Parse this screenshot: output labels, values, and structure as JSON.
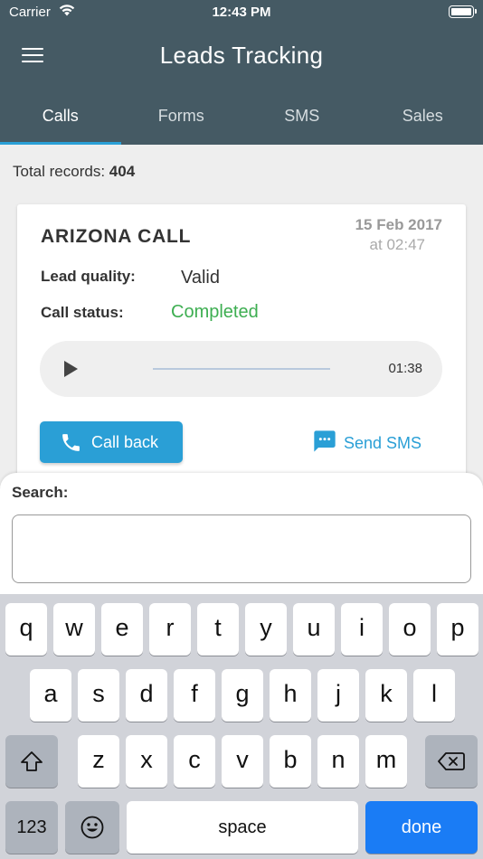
{
  "status_bar": {
    "carrier": "Carrier",
    "time": "12:43 PM"
  },
  "header": {
    "title": "Leads Tracking"
  },
  "tabs": [
    {
      "label": "Calls",
      "active": true
    },
    {
      "label": "Forms",
      "active": false
    },
    {
      "label": "SMS",
      "active": false
    },
    {
      "label": "Sales",
      "active": false
    }
  ],
  "summary": {
    "label": "Total records:",
    "count": "404"
  },
  "call": {
    "title": "ARIZONA CALL",
    "date": "15 Feb 2017",
    "time": "at 02:47",
    "quality_label": "Lead quality:",
    "quality_value": "Valid",
    "status_label": "Call status:",
    "status_value": "Completed",
    "duration": "01:38",
    "progress": 0,
    "callback_label": "Call back",
    "sms_label": "Send SMS"
  },
  "search": {
    "label": "Search:",
    "value": "",
    "placeholder": ""
  },
  "keyboard": {
    "row1": [
      "q",
      "w",
      "e",
      "r",
      "t",
      "y",
      "u",
      "i",
      "o",
      "p"
    ],
    "row2": [
      "a",
      "s",
      "d",
      "f",
      "g",
      "h",
      "j",
      "k",
      "l"
    ],
    "row3": [
      "z",
      "x",
      "c",
      "v",
      "b",
      "n",
      "m"
    ],
    "numbers_label": "123",
    "space_label": "space",
    "done_label": "done"
  },
  "colors": {
    "header": "#455a64",
    "accent": "#2a9fd6",
    "completed": "#3dae51",
    "done_key": "#1a7cf5"
  }
}
